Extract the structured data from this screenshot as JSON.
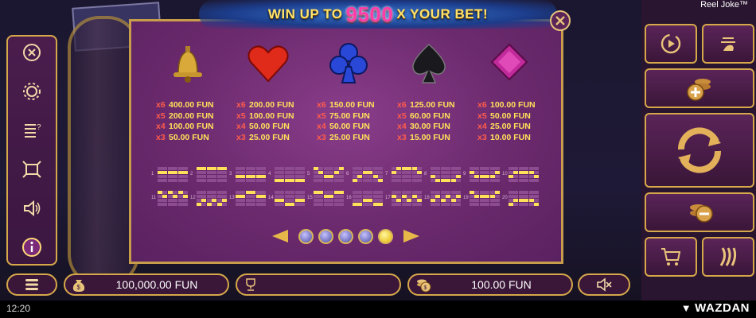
{
  "brand": "Reel Joke™",
  "banner": {
    "pre": "WIN UP TO",
    "amount": "9500",
    "post": "X YOUR BET!"
  },
  "colors": {
    "gold": "#d6a84a",
    "panel": "#6b2a6d",
    "payout": "#ffe15a",
    "multiplier": "#ff5c4c"
  },
  "symbols": [
    {
      "name": "bell-icon",
      "pays": [
        {
          "m": "x6",
          "v": "400.00 FUN"
        },
        {
          "m": "x5",
          "v": "200.00 FUN"
        },
        {
          "m": "x4",
          "v": "100.00 FUN"
        },
        {
          "m": "x3",
          "v": "50.00 FUN"
        }
      ]
    },
    {
      "name": "heart-icon",
      "pays": [
        {
          "m": "x6",
          "v": "200.00 FUN"
        },
        {
          "m": "x5",
          "v": "100.00 FUN"
        },
        {
          "m": "x4",
          "v": "50.00 FUN"
        },
        {
          "m": "x3",
          "v": "25.00 FUN"
        }
      ]
    },
    {
      "name": "club-icon",
      "pays": [
        {
          "m": "x6",
          "v": "150.00 FUN"
        },
        {
          "m": "x5",
          "v": "75.00 FUN"
        },
        {
          "m": "x4",
          "v": "50.00 FUN"
        },
        {
          "m": "x3",
          "v": "25.00 FUN"
        }
      ]
    },
    {
      "name": "spade-icon",
      "pays": [
        {
          "m": "x6",
          "v": "125.00 FUN"
        },
        {
          "m": "x5",
          "v": "60.00 FUN"
        },
        {
          "m": "x4",
          "v": "30.00 FUN"
        },
        {
          "m": "x3",
          "v": "15.00 FUN"
        }
      ]
    },
    {
      "name": "diamond-icon",
      "pays": [
        {
          "m": "x6",
          "v": "100.00 FUN"
        },
        {
          "m": "x5",
          "v": "50.00 FUN"
        },
        {
          "m": "x4",
          "v": "25.00 FUN"
        },
        {
          "m": "x3",
          "v": "10.00 FUN"
        }
      ]
    }
  ],
  "paylines": [
    {
      "num": "1",
      "rows": [
        1,
        1,
        1,
        1,
        1,
        1
      ]
    },
    {
      "num": "2",
      "rows": [
        0,
        0,
        0,
        0,
        0,
        0
      ]
    },
    {
      "num": "3",
      "rows": [
        2,
        2,
        2,
        2,
        2,
        2
      ]
    },
    {
      "num": "4",
      "rows": [
        3,
        3,
        3,
        3,
        3,
        3
      ]
    },
    {
      "num": "5",
      "rows": [
        0,
        1,
        2,
        2,
        1,
        0
      ]
    },
    {
      "num": "6",
      "rows": [
        3,
        2,
        1,
        1,
        2,
        3
      ]
    },
    {
      "num": "7",
      "rows": [
        1,
        0,
        0,
        0,
        0,
        1
      ]
    },
    {
      "num": "8",
      "rows": [
        2,
        3,
        3,
        3,
        3,
        2
      ]
    },
    {
      "num": "9",
      "rows": [
        1,
        2,
        2,
        2,
        2,
        1
      ]
    },
    {
      "num": "10",
      "rows": [
        2,
        1,
        1,
        1,
        1,
        2
      ]
    },
    {
      "num": "11",
      "rows": [
        0,
        1,
        0,
        1,
        0,
        1
      ]
    },
    {
      "num": "12",
      "rows": [
        3,
        2,
        3,
        2,
        3,
        2
      ]
    },
    {
      "num": "13",
      "rows": [
        1,
        1,
        0,
        0,
        1,
        1
      ]
    },
    {
      "num": "14",
      "rows": [
        2,
        2,
        3,
        3,
        2,
        2
      ]
    },
    {
      "num": "15",
      "rows": [
        0,
        0,
        1,
        1,
        0,
        0
      ]
    },
    {
      "num": "16",
      "rows": [
        3,
        3,
        2,
        2,
        3,
        3
      ]
    },
    {
      "num": "17",
      "rows": [
        1,
        2,
        1,
        2,
        1,
        2
      ]
    },
    {
      "num": "18",
      "rows": [
        2,
        1,
        2,
        1,
        2,
        1
      ]
    },
    {
      "num": "19",
      "rows": [
        0,
        1,
        1,
        1,
        1,
        0
      ]
    },
    {
      "num": "20",
      "rows": [
        3,
        2,
        2,
        2,
        2,
        3
      ]
    }
  ],
  "pager": {
    "pages": 5,
    "active": 5
  },
  "bottom": {
    "balance": "100,000.00 FUN",
    "win": "",
    "bet": "100.00 FUN"
  },
  "clock": "12:20",
  "provider": "WAZDAN"
}
